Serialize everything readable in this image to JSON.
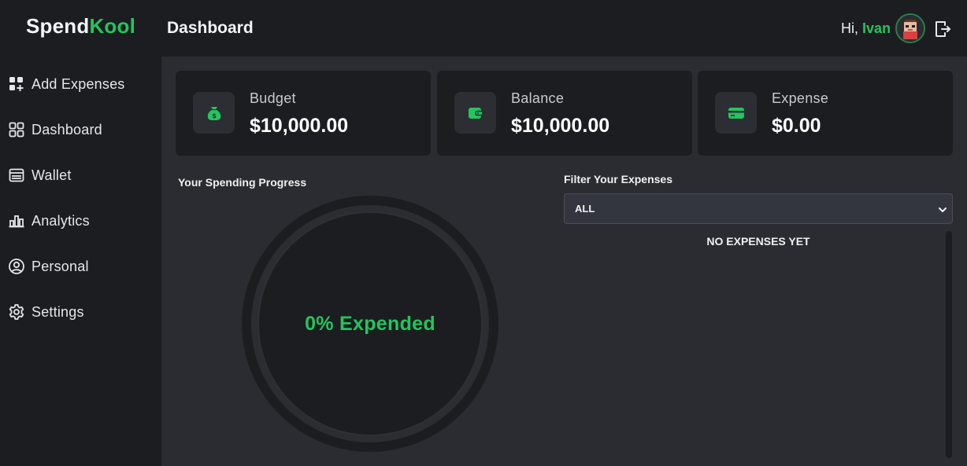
{
  "header": {
    "logo_main": "Spend",
    "logo_accent": "Kool",
    "title": "Dashboard",
    "greeting": "Hi, ",
    "user_name": "Ivan"
  },
  "sidebar": {
    "items": [
      {
        "label": "Add Expenses",
        "icon": "add-grid-icon"
      },
      {
        "label": "Dashboard",
        "icon": "grid-icon"
      },
      {
        "label": "Wallet",
        "icon": "wallet-icon"
      },
      {
        "label": "Analytics",
        "icon": "bar-chart-icon"
      },
      {
        "label": "Personal",
        "icon": "user-icon"
      },
      {
        "label": "Settings",
        "icon": "gear-icon"
      }
    ]
  },
  "cards": [
    {
      "label": "Budget",
      "value": "$10,000.00",
      "icon": "money-bag-icon"
    },
    {
      "label": "Balance",
      "value": "$10,000.00",
      "icon": "wallet-icon"
    },
    {
      "label": "Expense",
      "value": "$0.00",
      "icon": "credit-card-icon"
    }
  ],
  "progress": {
    "title": "Your Spending Progress",
    "text": "0% Expended",
    "percent": 0
  },
  "filter": {
    "title": "Filter Your Expenses",
    "selected": "ALL"
  },
  "expenses": {
    "empty_message": "NO EXPENSES YET"
  },
  "colors": {
    "accent": "#22c55e",
    "background": "#1c1d20",
    "panel": "#2a2c31"
  }
}
